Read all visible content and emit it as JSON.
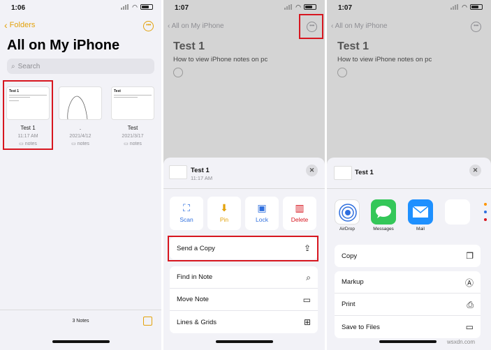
{
  "status": {
    "p1_time": "1:06",
    "p2_time": "1:07",
    "p3_time": "1:07"
  },
  "panel1": {
    "back_label": "Folders",
    "title": "All on My iPhone",
    "search_placeholder": "Search",
    "notes": [
      {
        "thumb_title": "Test 1",
        "name": "Test 1",
        "date": "11:17 AM",
        "folder": "notes"
      },
      {
        "thumb_title": "",
        "name": ".",
        "date": "2021/4/12",
        "folder": "notes"
      },
      {
        "thumb_title": "Test",
        "name": "Test",
        "date": "2021/3/17",
        "folder": "notes"
      }
    ],
    "count_label": "3 Notes"
  },
  "note_bg": {
    "back_label": "All on My iPhone",
    "title": "Test 1",
    "body": "How to view iPhone notes on pc"
  },
  "panel2_sheet": {
    "note_title": "Test 1",
    "note_time": "11:17 AM",
    "actions": [
      {
        "label": "Scan",
        "icon": "scan-icon",
        "glyph": "⛶",
        "color": "#2f6fde"
      },
      {
        "label": "Pin",
        "icon": "pin-icon",
        "glyph": "📌",
        "color": "#e3a20b"
      },
      {
        "label": "Lock",
        "icon": "lock-icon",
        "glyph": "🔒",
        "color": "#2f6fde"
      },
      {
        "label": "Delete",
        "icon": "trash-icon",
        "glyph": "🗑",
        "color": "#d7161f"
      }
    ],
    "send_copy": {
      "label": "Send a Copy",
      "icon": "share-icon",
      "glyph": "⇪"
    },
    "rows": [
      {
        "label": "Find in Note",
        "icon": "search-icon",
        "glyph": "⌕"
      },
      {
        "label": "Move Note",
        "icon": "folder-icon",
        "glyph": "▭"
      },
      {
        "label": "Lines & Grids",
        "icon": "grid-icon",
        "glyph": "⊞"
      }
    ]
  },
  "panel3_sheet": {
    "note_title": "Test 1",
    "apps": [
      {
        "label": "AirDrop",
        "icon": "airdrop-icon",
        "color": "#ffffff"
      },
      {
        "label": "Messages",
        "icon": "messages-icon",
        "color": "#34c759"
      },
      {
        "label": "Mail",
        "icon": "mail-icon",
        "color": "#1e90ff"
      },
      {
        "label": "",
        "icon": "blank-app-icon",
        "color": "#ffffff"
      }
    ],
    "rows_a": [
      {
        "label": "Copy",
        "icon": "copy-icon",
        "glyph": "❐"
      }
    ],
    "rows_b": [
      {
        "label": "Markup",
        "icon": "markup-icon",
        "glyph": "Ⓐ"
      },
      {
        "label": "Print",
        "icon": "print-icon",
        "glyph": "⎙"
      },
      {
        "label": "Save to Files",
        "icon": "folder-icon",
        "glyph": "▭"
      }
    ]
  },
  "colors": {
    "accent": "#e3a20b",
    "highlight": "#d7161f",
    "blue": "#2f6fde"
  },
  "watermark": "wsxdn.com"
}
